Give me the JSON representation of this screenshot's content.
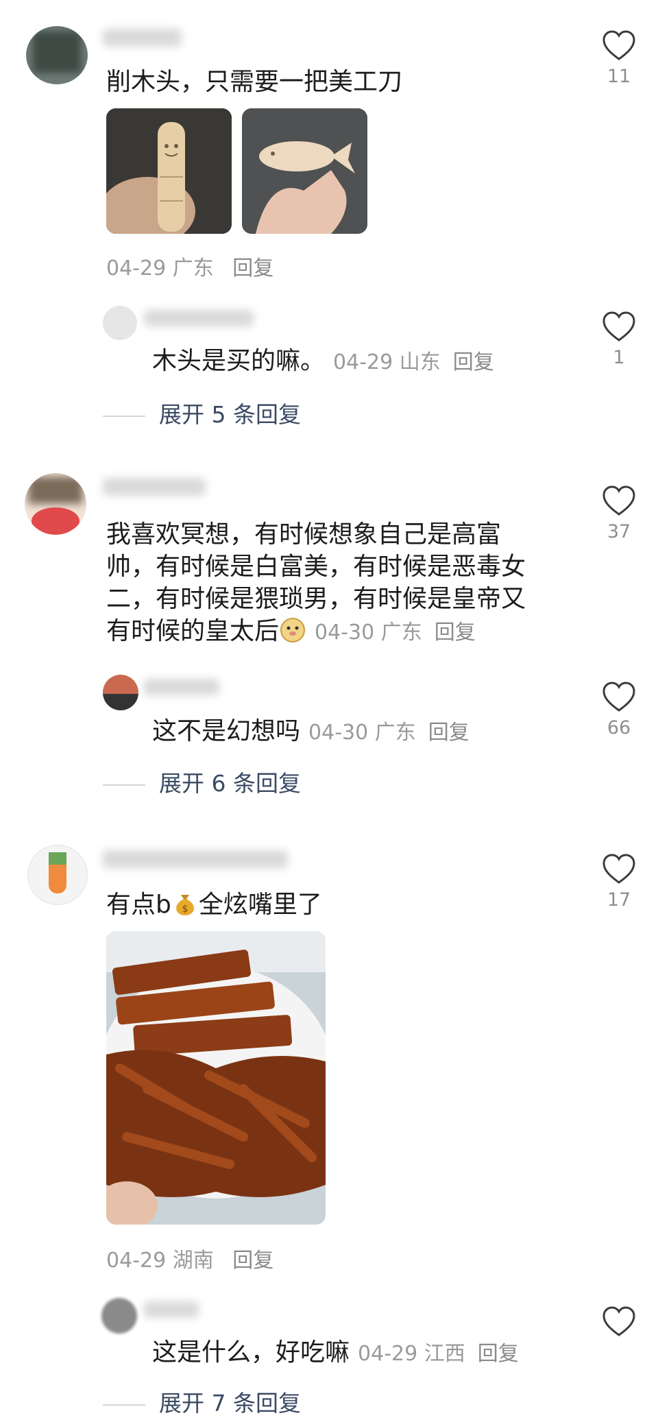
{
  "comments": [
    {
      "text": "削木头，只需要一把美工刀",
      "date": "04-29",
      "location": "广东",
      "reply_label": "回复",
      "likes": "11",
      "images": [
        "carved-figure-photo",
        "carved-fish-photo"
      ],
      "sub_reply": {
        "text": "木头是买的嘛。",
        "date": "04-29",
        "location": "山东",
        "reply_label": "回复",
        "likes": "1"
      },
      "expand_label": "展开 5 条回复"
    },
    {
      "text_lines": [
        "我喜欢冥想，有时候想象自己是高富",
        "帅，有时候是白富美，有时候是恶毒女",
        "二，有时候是猥琐男，有时候是皇帝又",
        "有时候的皇太后"
      ],
      "date": "04-30",
      "location": "广东",
      "reply_label": "回复",
      "likes": "37",
      "sub_reply": {
        "text": "这不是幻想吗",
        "date": "04-30",
        "location": "广东",
        "reply_label": "回复",
        "likes": "66"
      },
      "expand_label": "展开 6 条回复"
    },
    {
      "text_before": "有点b",
      "text_after": "全炫嘴里了",
      "date": "04-29",
      "location": "湖南",
      "reply_label": "回复",
      "likes": "17",
      "images": [
        "spicy-snack-photo"
      ],
      "sub_reply": {
        "text": "这是什么，好吃嘛",
        "date": "04-29",
        "location": "江西",
        "reply_label": "回复",
        "likes": ""
      },
      "expand_label": "展开 7 条回复"
    }
  ]
}
